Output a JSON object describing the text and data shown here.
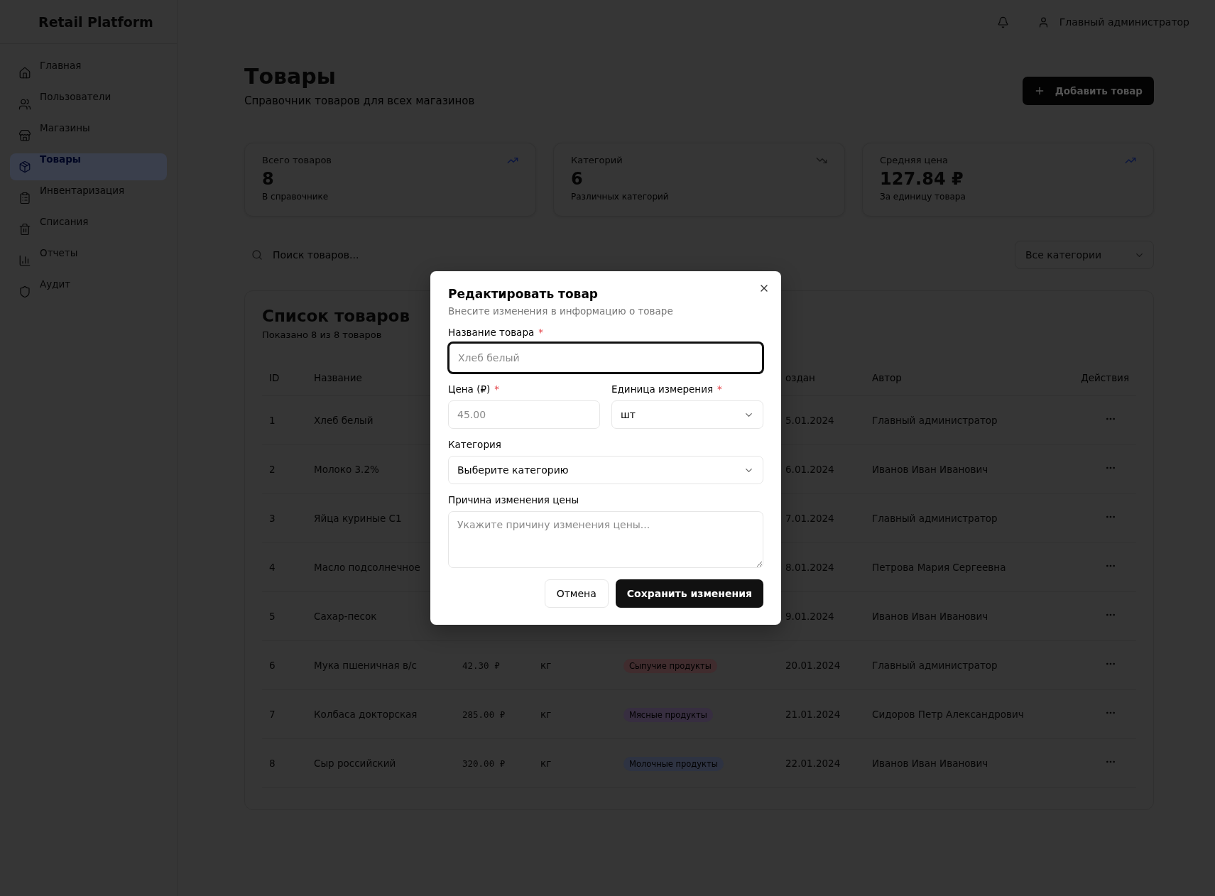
{
  "brand": "Retail Platform",
  "sidebar": {
    "items": [
      {
        "label": "Главная",
        "selected": false
      },
      {
        "label": "Пользователи",
        "selected": false
      },
      {
        "label": "Магазины",
        "selected": false
      },
      {
        "label": "Товары",
        "selected": true
      },
      {
        "label": "Инвентаризация",
        "selected": false
      },
      {
        "label": "Списания",
        "selected": false
      },
      {
        "label": "Отчеты",
        "selected": false
      },
      {
        "label": "Аудит",
        "selected": false
      }
    ]
  },
  "topbar": {
    "user": "Главный администратор"
  },
  "page": {
    "title": "Товары",
    "subtitle": "Справочник товаров для всех магазинов",
    "add_button": "Добавить товар"
  },
  "stats": [
    {
      "label": "Всего товаров",
      "value": "8",
      "note": "В справочнике",
      "rising": true
    },
    {
      "label": "Категорий",
      "value": "6",
      "note": "Различных категорий",
      "rising": false
    },
    {
      "label": "Средняя цена",
      "value": "127.84 ₽",
      "note": "За единицу товара",
      "rising": true
    }
  ],
  "filters": {
    "search_placeholder": "Поиск товаров...",
    "category": "Все категории"
  },
  "table": {
    "title": "Список товаров",
    "subtitle": "Показано 8 из 8 товаров",
    "columns": [
      "ID",
      "Название",
      null,
      null,
      null,
      "оздан",
      "Автор",
      "Действия"
    ],
    "rows": [
      {
        "id": "1",
        "name": "Хлеб белый",
        "created": "5.01.2024",
        "author": "Главный администратор"
      },
      {
        "id": "2",
        "name": "Молоко 3.2%",
        "created": "6.01.2024",
        "author": "Иванов Иван Иванович"
      },
      {
        "id": "3",
        "name": "Яйца куриные С1",
        "created": "7.01.2024",
        "author": "Главный администратор"
      },
      {
        "id": "4",
        "name": "Масло подсолнечное",
        "created": "8.01.2024",
        "author": "Петрова Мария Сергеевна"
      },
      {
        "id": "5",
        "name": "Сахар-песок",
        "created": "9.01.2024",
        "author": "Иванов Иван Иванович"
      },
      {
        "id": "6",
        "name": "Мука пшеничная в/с",
        "price": "42.30 ₽",
        "unit": "кг",
        "category": "Сыпучие продукты",
        "color": "#402c2e",
        "created": "20.01.2024",
        "author": "Главный администратор"
      },
      {
        "id": "7",
        "name": "Колбаса докторская",
        "price": "285.00 ₽",
        "unit": "кг",
        "category": "Мясные продукты",
        "color": "#372e40",
        "created": "21.01.2024",
        "author": "Сидоров Петр Александрович"
      },
      {
        "id": "8",
        "name": "Сыр российский",
        "price": "320.00 ₽",
        "unit": "кг",
        "category": "Молочные продукты",
        "color": "#2e3342",
        "created": "22.01.2024",
        "author": "Иванов Иван Иванович"
      }
    ]
  },
  "dialog": {
    "title": "Редактировать товар",
    "description": "Внесите изменения в информацию о товаре",
    "name_label": "Название товара",
    "name_mark": "*",
    "name_placeholder": "Хлеб белый",
    "price_label": "Цена (₽)",
    "price_mark": "*",
    "price_placeholder": "45.00",
    "unit_label": "Единица измерения",
    "unit_mark": "*",
    "unit_value": "шт",
    "category_label": "Категория",
    "category_value": "Выберите категорию",
    "reason_label": "Причина изменения цены",
    "reason_placeholder": "Укажите причину изменения цены...",
    "cancel": "Отмена",
    "save": "Сохранить изменения"
  }
}
